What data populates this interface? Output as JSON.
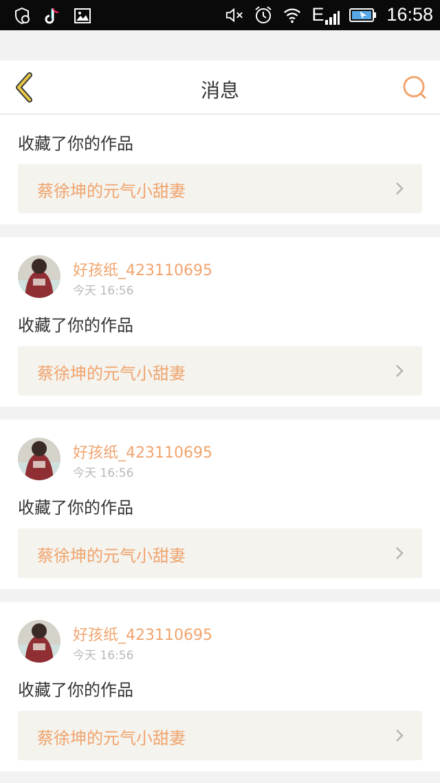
{
  "status_bar": {
    "time": "16:58",
    "network": "E",
    "icons": [
      "shield-check-icon",
      "tiktok-icon",
      "image-icon",
      "mute-icon",
      "alarm-icon",
      "wifi-icon",
      "signal-icon",
      "battery-charging-icon"
    ]
  },
  "header": {
    "title": "消息",
    "back_icon": "chevron-left-icon",
    "search_icon": "search-icon"
  },
  "messages": [
    {
      "action": "收藏了你的作品",
      "work_title": "蔡徐坤的元气小甜妻"
    },
    {
      "user": "好孩纸_423110695",
      "time": "今天 16:56",
      "action": "收藏了你的作品",
      "work_title": "蔡徐坤的元气小甜妻"
    },
    {
      "user": "好孩纸_423110695",
      "time": "今天 16:56",
      "action": "收藏了你的作品",
      "work_title": "蔡徐坤的元气小甜妻"
    },
    {
      "user": "好孩纸_423110695",
      "time": "今天 16:56",
      "action": "收藏了你的作品",
      "work_title": "蔡徐坤的元气小甜妻"
    }
  ],
  "colors": {
    "accent": "#f0a46e",
    "back_arrow": "#e8c845",
    "card_bg": "#f4f3ee",
    "page_bg": "#f2f2f2"
  }
}
